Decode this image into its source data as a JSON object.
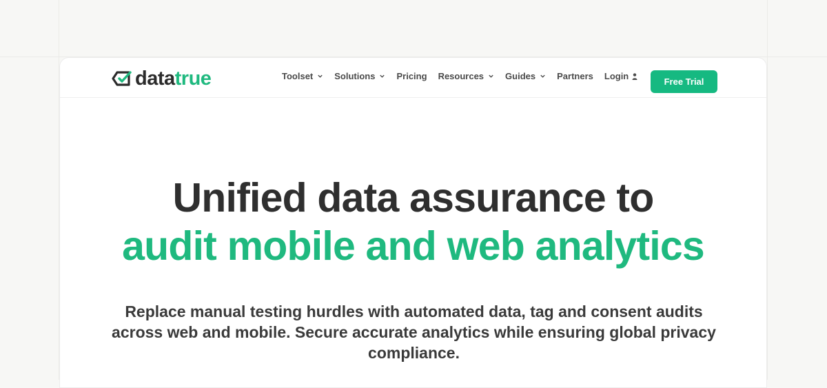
{
  "logo": {
    "text_main": "data",
    "text_accent": "true"
  },
  "nav": {
    "items": [
      {
        "label": "Toolset",
        "has_dropdown": true
      },
      {
        "label": "Solutions",
        "has_dropdown": true
      },
      {
        "label": "Pricing",
        "has_dropdown": false
      },
      {
        "label": "Resources",
        "has_dropdown": true
      },
      {
        "label": "Guides",
        "has_dropdown": true
      },
      {
        "label": "Partners",
        "has_dropdown": false
      }
    ],
    "login_label": "Login",
    "cta_label": "Free Trial"
  },
  "hero": {
    "title_line1": "Unified data assurance to",
    "title_line2": "audit mobile and web analytics",
    "subtitle": "Replace manual testing hurdles with automated data, tag and consent audits across web and mobile. Secure accurate analytics while ensuring global privacy compliance."
  },
  "colors": {
    "accent": "#1fb97f",
    "cta": "#16b981",
    "text": "#2f2f2f",
    "background": "#f7f7f5"
  }
}
